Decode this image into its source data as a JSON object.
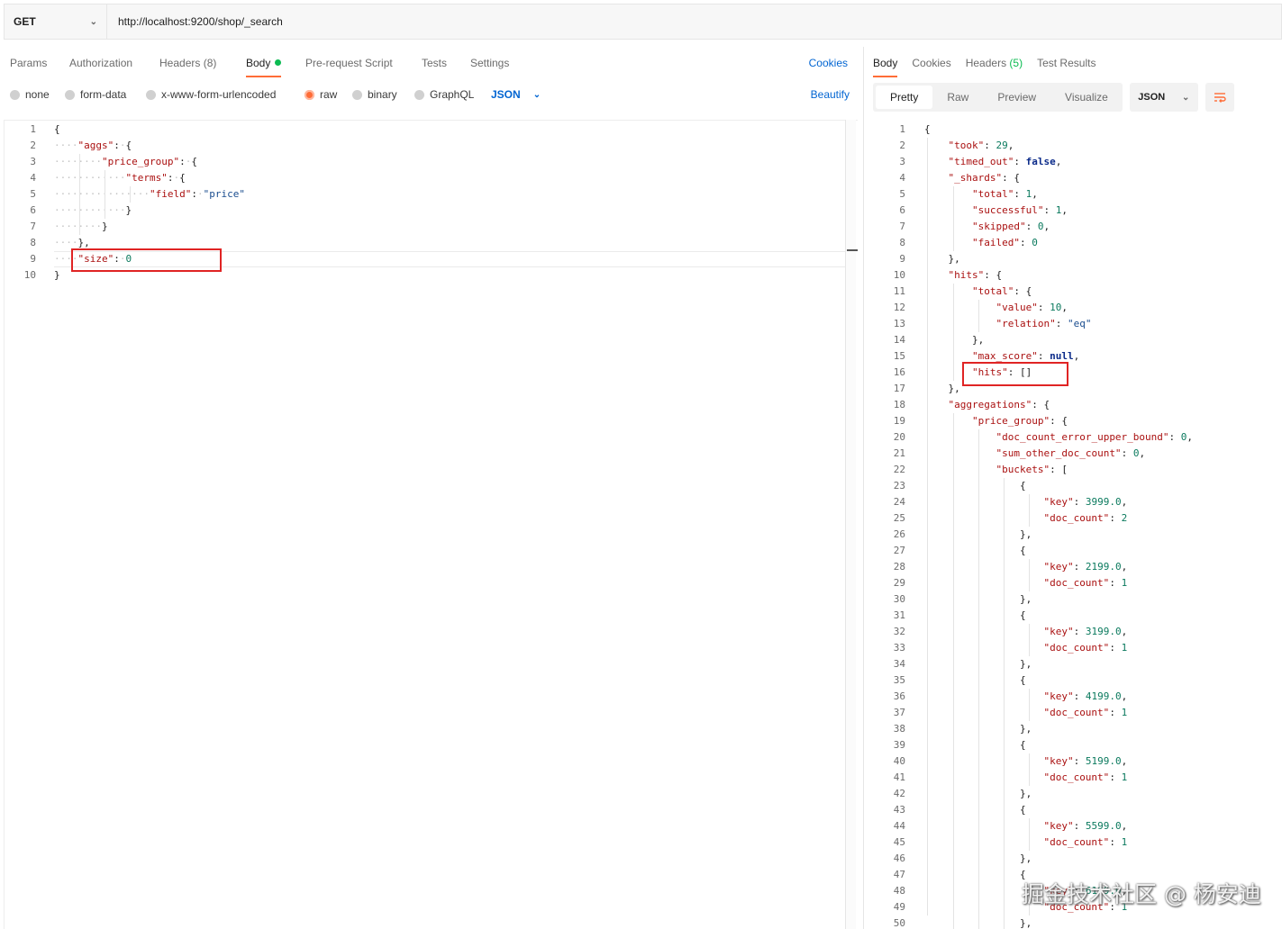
{
  "request": {
    "method": "GET",
    "url": "http://localhost:9200/shop/_search"
  },
  "request_tabs": [
    "Params",
    "Authorization",
    "Headers (8)",
    "Body",
    "Pre-request Script",
    "Tests",
    "Settings"
  ],
  "active_request_tab": "Body",
  "cookies_link": "Cookies",
  "body_types": [
    "none",
    "form-data",
    "x-www-form-urlencoded",
    "raw",
    "binary",
    "GraphQL"
  ],
  "selected_body_type": "raw",
  "body_format": "JSON",
  "beautify_label": "Beautify",
  "request_body_lines": [
    "{",
    "    \"aggs\": {",
    "        \"price_group\": {",
    "            \"terms\": {",
    "                \"field\": \"price\"",
    "            }",
    "        }",
    "    },",
    "    \"size\": 0",
    "}"
  ],
  "response_tabs": [
    "Body",
    "Cookies",
    "Headers (5)",
    "Test Results"
  ],
  "active_response_tab": "Body",
  "response_views": [
    "Pretty",
    "Raw",
    "Preview",
    "Visualize"
  ],
  "active_response_view": "Pretty",
  "response_format": "JSON",
  "response_body_lines": [
    "{",
    "    \"took\": 29,",
    "    \"timed_out\": false,",
    "    \"_shards\": {",
    "        \"total\": 1,",
    "        \"successful\": 1,",
    "        \"skipped\": 0,",
    "        \"failed\": 0",
    "    },",
    "    \"hits\": {",
    "        \"total\": {",
    "            \"value\": 10,",
    "            \"relation\": \"eq\"",
    "        },",
    "        \"max_score\": null,",
    "        \"hits\": []",
    "    },",
    "    \"aggregations\": {",
    "        \"price_group\": {",
    "            \"doc_count_error_upper_bound\": 0,",
    "            \"sum_other_doc_count\": 0,",
    "            \"buckets\": [",
    "                {",
    "                    \"key\": 3999.0,",
    "                    \"doc_count\": 2",
    "                },",
    "                {",
    "                    \"key\": 2199.0,",
    "                    \"doc_count\": 1",
    "                },",
    "                {",
    "                    \"key\": 3199.0,",
    "                    \"doc_count\": 1",
    "                },",
    "                {",
    "                    \"key\": 4199.0,",
    "                    \"doc_count\": 1",
    "                },",
    "                {",
    "                    \"key\": 5199.0,",
    "                    \"doc_count\": 1",
    "                },",
    "                {",
    "                    \"key\": 5599.0,",
    "                    \"doc_count\": 1",
    "                },",
    "                {",
    "                    \"key\": 6199.0,",
    "                    \"doc_count\": 1",
    "                },"
  ],
  "watermark": "掘金技术社区 @ 杨安迪",
  "colors": {
    "accent": "#ff6c37",
    "link": "#0265d2",
    "success_dot": "#0cbb52",
    "highlight_box": "#e02424"
  },
  "icons": [
    "chevron-down-icon",
    "word-wrap-icon"
  ]
}
